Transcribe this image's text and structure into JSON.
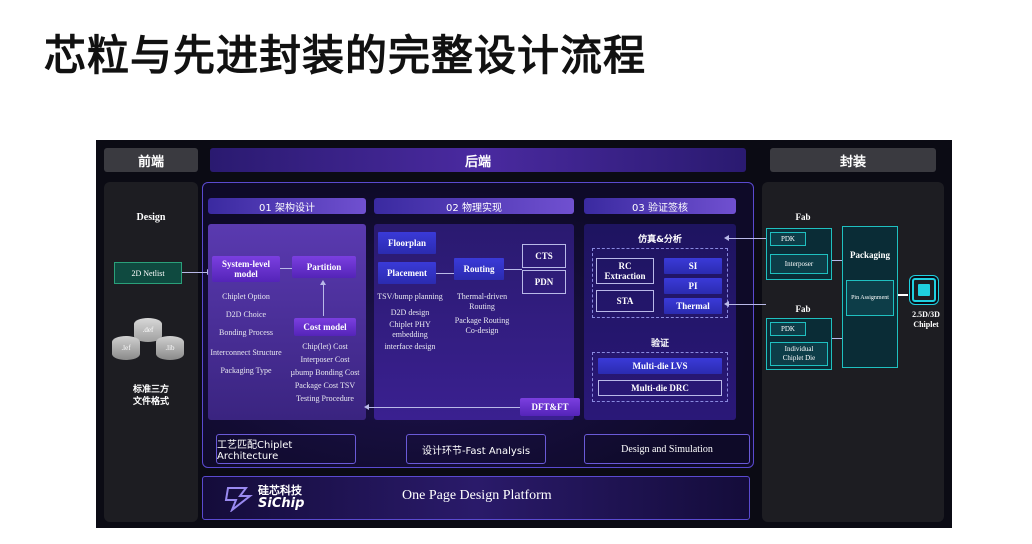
{
  "title": "芯粒与先进封装的完整设计流程",
  "colors": {
    "accent": "#7b3fe0",
    "blue": "#2b2bb0",
    "teal": "#1fc0c0",
    "bg": "#0b0b14"
  },
  "headers": {
    "frontend": "前端",
    "backend": "后端",
    "packaging": "封装"
  },
  "frontend": {
    "design": "Design",
    "netlist": "2D Netlist",
    "files": {
      "def": ".def",
      "lef": ".lef",
      "lib": ".lib"
    },
    "note_line1": "标准三方",
    "note_line2": "文件格式"
  },
  "sections": {
    "s1": "01  架构设计",
    "s2": "02  物理实现",
    "s3": "03  验证签核"
  },
  "arch": {
    "system_line1": "System-level",
    "system_line2": "model",
    "partition": "Partition",
    "items": [
      "Chiplet Option",
      "D2D Choice",
      "Bonding Process",
      "Interconnect Structure",
      "Packaging Type"
    ],
    "cost_model": "Cost model",
    "cost_items": [
      "Chip(let) Cost",
      "Interposer Cost",
      "µbump Bonding Cost",
      "Package Cost TSV",
      "Testing Procedure"
    ]
  },
  "phys": {
    "floorplan": "Floorplan",
    "placement": "Placement",
    "routing": "Routing",
    "cts": "CTS",
    "pdn": "PDN",
    "placement_items": [
      "TSV/bump planning",
      "D2D design",
      "Chiplet PHY",
      "embedding",
      "interface design"
    ],
    "routing_items": [
      "Thermal-driven",
      "Routing",
      "Package Routing",
      "Co-design"
    ],
    "dft": "DFT&FT"
  },
  "verify": {
    "sim_title": "仿真&分析",
    "rc_line1": "RC",
    "rc_line2": "Extraction",
    "si": "SI",
    "pi": "PI",
    "sta": "STA",
    "thermal": "Thermal",
    "verify_title": "验证",
    "lvs": "Multi-die LVS",
    "drc": "Multi-die DRC"
  },
  "package": {
    "fab1": "Fab",
    "pdk1": "PDK",
    "interposer": "Interposer",
    "fab2": "Fab",
    "pdk2": "PDK",
    "die_line1": "Individual",
    "die_line2": "Chiplet Die",
    "packaging": "Packaging",
    "pin": "Pin Assignment",
    "result_line1": "2.5D/3D",
    "result_line2": "Chiplet"
  },
  "bottom": {
    "b1": "工艺匹配Chiplet Architecture",
    "b2": "设计环节-Fast Analysis",
    "b3": "Design and Simulation",
    "logo_cn": "硅芯科技",
    "logo_en": "SiChip",
    "platform": "One Page Design Platform"
  }
}
